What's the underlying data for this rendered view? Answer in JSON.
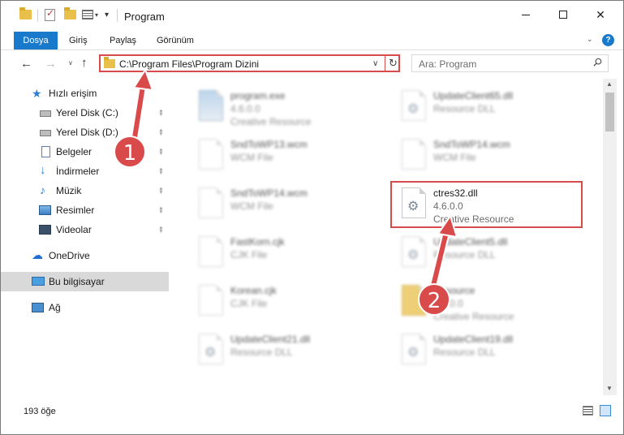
{
  "window": {
    "title": "Program",
    "quick_access_arrow": "▾"
  },
  "ribbon": {
    "tabs": [
      {
        "label": "Dosya"
      },
      {
        "label": "Giriş"
      },
      {
        "label": "Paylaş"
      },
      {
        "label": "Görünüm"
      }
    ],
    "help_label": "?",
    "expand_glyph": "⌄"
  },
  "nav": {
    "back_glyph": "←",
    "forward_glyph": "→",
    "recent_glyph": "∨",
    "up_glyph": "↑",
    "address": "C:\\Program Files\\Program Dizini",
    "address_dropdown": "∨",
    "refresh_glyph": "↻",
    "search_placeholder": "Ara: Program"
  },
  "sidebar": {
    "items": [
      {
        "label": "Hızlı erişim",
        "icon": "star-icon"
      },
      {
        "label": "Yerel Disk (C:)",
        "icon": "drive-icon"
      },
      {
        "label": "Yerel Disk (D:)",
        "icon": "drive-icon"
      },
      {
        "label": "Belgeler",
        "icon": "documents-icon"
      },
      {
        "label": "İndirmeler",
        "icon": "downloads-icon"
      },
      {
        "label": "Müzik",
        "icon": "music-icon"
      },
      {
        "label": "Resimler",
        "icon": "pictures-icon"
      },
      {
        "label": "Videolar",
        "icon": "videos-icon"
      },
      {
        "label": "OneDrive",
        "icon": "cloud-icon"
      },
      {
        "label": "Bu bilgisayar",
        "icon": "computer-icon"
      },
      {
        "label": "Ağ",
        "icon": "network-icon"
      }
    ],
    "pin_glyph": "📌"
  },
  "files": [
    {
      "name": "program.exe",
      "type": "4.6.0.0",
      "desc": "Creative Resource"
    },
    {
      "name": "UpdateClient65.dll",
      "type": "Resource DLL",
      "desc": ""
    },
    {
      "name": "SndToWP13.wcm",
      "type": "WCM File",
      "desc": ""
    },
    {
      "name": "SndToWP14.wcm",
      "type": "WCM File",
      "desc": ""
    },
    {
      "name": "SndToWP14.wcm",
      "type": "WCM File",
      "desc": ""
    },
    {
      "name": "ctres32.dll",
      "type": "4.6.0.0",
      "desc": "Creative Resource"
    },
    {
      "name": "FastKorn.cjk",
      "type": "CJK File",
      "desc": ""
    },
    {
      "name": "UpdateClient5.dll",
      "type": "Resource DLL",
      "desc": ""
    },
    {
      "name": "Korean.cjk",
      "type": "CJK File",
      "desc": ""
    },
    {
      "name": "Resource",
      "type": "4.6.0.0",
      "desc": "Creative Resource"
    },
    {
      "name": "UpdateClient21.dll",
      "type": "Resource DLL",
      "desc": ""
    },
    {
      "name": "UpdateClient19.dll",
      "type": "Resource DLL",
      "desc": ""
    }
  ],
  "status": {
    "count": "193 öğe"
  },
  "annotations": {
    "badge1": "1",
    "badge2": "2",
    "color": "#d94a4a"
  }
}
